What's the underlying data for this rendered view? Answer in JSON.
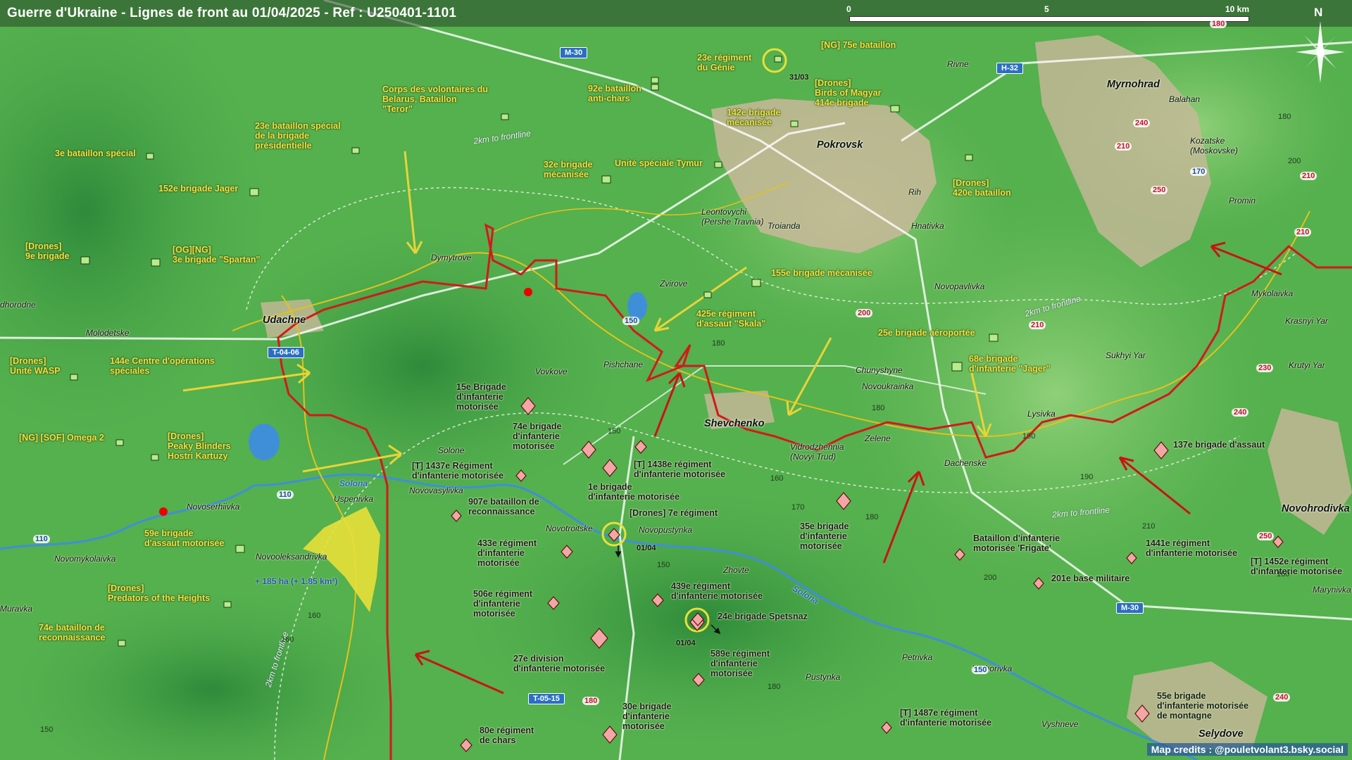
{
  "map_title": "Guerre d'Ukraine - Lignes de front au 01/04/2025 - Ref : U250401-1101",
  "scale": {
    "labels": [
      "0",
      "5",
      "10 km"
    ]
  },
  "compass": {
    "label": "N"
  },
  "credits": "Map credits : @pouletvolant3.bsky.social",
  "colors": {
    "front_line": "#d21a1a",
    "ua_lines": "#e4c21a",
    "terrain": "#4aa848",
    "road_sign": "#2b6fc2",
    "gain": "#e8e03a"
  },
  "ukrainian_units": [
    "Corps des volontaires du\nBelarus, Bataillon\n\"Teror\"",
    "92e bataillon\nanti-chars",
    "23e régiment\ndu Génie",
    "[NG] 75e bataillon",
    "[Drones]\nBirds of Magyar\n414e brigade",
    "142e brigade\nmécanisée",
    "23e bataillon spécial\nde la brigade\nprésidentielle",
    "3e bataillon spécial",
    "152e brigade Jager",
    "32e brigade\nmécanisée",
    "Unité spéciale Tymur",
    "[Drones]\n420e bataillon",
    "[Drones]\n9e brigade",
    "[OG][NG]\n3e brigade \"Spartan\"",
    "155e brigade mécanisée",
    "425e régiment\nd'assaut \"Skala\"",
    "25e brigade aéroportée",
    "68e brigade\nd'infanterie \"Jager\"",
    "[Drones]\nUnité WASP",
    "144e Centre d'opérations\nspéciales",
    "[NG] [SOF] Omega 2",
    "[Drones]\nPeaky Blinders\nHostri Kartuzy",
    "59e brigade\nd'assaut motorisée",
    "[Drones]\nPredators of the Heights",
    "74e bataillon de\nreconnaissance"
  ],
  "russian_units": [
    "15e Brigade\nd'infanterie\nmotorisée",
    "74e brigade\nd'infanterie\nmotorisée",
    "[T] 1437e Régiment\nd'infanterie motorisée",
    "[T] 1438e régiment\nd'infanterie motorisée",
    "1e brigade\nd'infanterie motorisée",
    "907e bataillon de\nreconnaissance",
    "[Drones] 7e régiment",
    "433e régiment\nd'infanterie\nmotorisée",
    "506e régiment\nd'infanterie\nmotorisée",
    "439e régiment\nd'infanterie motorisée",
    "24e brigade Spetsnaz",
    "27e division\nd'infanterie motorisée",
    "589e régiment\nd'infanterie\nmotorisée",
    "30e brigade\nd'infanterie\nmotorisée",
    "80e régiment\nde chars",
    "35e brigade\nd'infanterie\nmotorisée",
    "Bataillon d'infanterie\nmotorisée 'Frigate'",
    "201e base militaire",
    "1441e régiment\nd'infanterie motorisée",
    "[T] 1452e régiment\nd'infanterie motorisée",
    "137e brigade d'assaut",
    "[T] 1487e régiment\nd'infanterie motorisée",
    "55e brigade\nd'infanterie motorisée\nde montagne"
  ],
  "cities": [
    "Pokrovsk",
    "Myrnohrad",
    "Udachne",
    "Shevchenko",
    "Novohrodivka",
    "Selydove"
  ],
  "towns": [
    "Rivne",
    "Balahan",
    "Kozatske\n(Moskovske)",
    "Promin",
    "Rih",
    "Troianda",
    "Leontovychi\n(Pershe Travnia)",
    "Hnativka",
    "Dymytrove",
    "Zvirove",
    "Novopavlivka",
    "Mykolaivka",
    "Krasnyi Yar",
    "Sukhyi Yar",
    "Krutyi Yar",
    "Chunyshyne",
    "Novoukrainka",
    "Lysivka",
    "Zelene",
    "Dachenske",
    "Vidrodzhennia\n(Novyi Trud)",
    "Pishchane",
    "Vovkove",
    "Molodetske",
    "dhorodne",
    "Solone",
    "Novovasylivka",
    "Uspenivka",
    "Novoserhiivka",
    "Novomykolaivka",
    "Novooleksandrivka",
    "Muravka",
    "Novotroitske",
    "Novopustynka",
    "Zhovte",
    "Petrivka",
    "Hryhorivka",
    "Pustynka",
    "Vyshneve",
    "Marynivka"
  ],
  "rivers": [
    "Solona",
    "Solona"
  ],
  "front_annotations": [
    "2km to frontline",
    "2km to frontline",
    "2km to frontline",
    "2km to frontline"
  ],
  "roads": [
    "M-30",
    "H-32",
    "T-04-06",
    "T-05-15",
    "M-30"
  ],
  "route_numbers": [
    "180",
    "210",
    "210",
    "240",
    "250",
    "170",
    "210",
    "200",
    "210",
    "230",
    "240",
    "250",
    "150",
    "110",
    "110",
    "180",
    "150",
    "240"
  ],
  "elevations": [
    "180",
    "200",
    "180",
    "180",
    "150",
    "160",
    "170",
    "180",
    "190",
    "190",
    "150",
    "200",
    "210",
    "180",
    "160",
    "160",
    "150",
    "160"
  ],
  "dates": [
    "31/03",
    "01/04",
    "01/04"
  ],
  "gain": "+ 185 ha (+ 1.85 km²)"
}
